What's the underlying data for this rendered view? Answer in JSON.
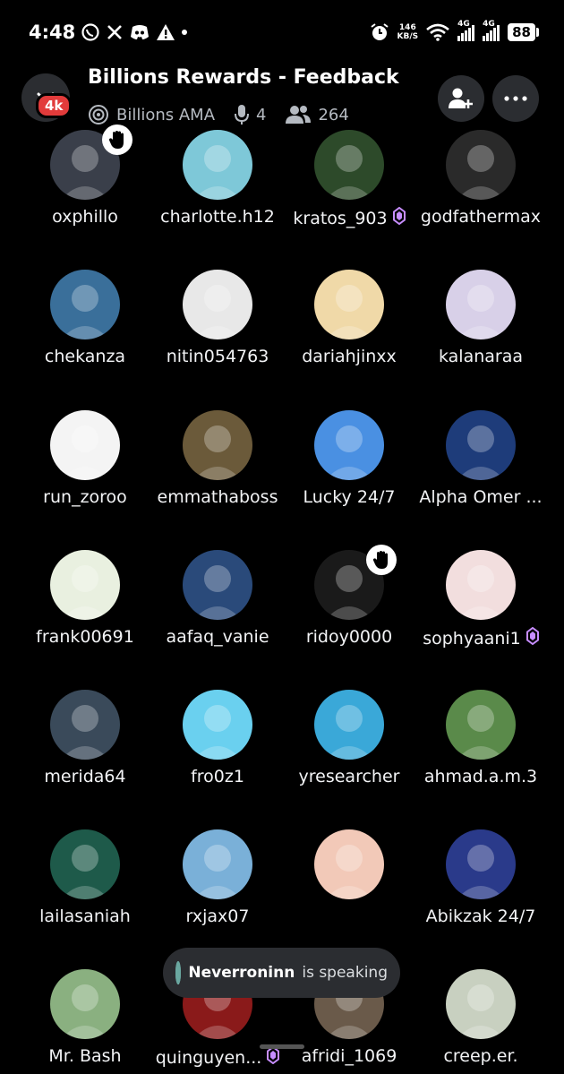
{
  "status_bar": {
    "time": "4:48",
    "net_speed_value": "146",
    "net_speed_unit": "KB/S",
    "sig1_tag": "4G",
    "sig2_tag": "4G",
    "battery": "88"
  },
  "header": {
    "notification_badge": "4k",
    "title": "Billions Rewards - Feedback",
    "stage_name": "Billions AMA",
    "speaker_count": "4",
    "listener_count": "264"
  },
  "participants": [
    {
      "name": "oxphillo",
      "avatar_bg": "#3a3f4a",
      "nitro": false,
      "hand_raised": true
    },
    {
      "name": "charlotte.h12",
      "avatar_bg": "#7ec8d8",
      "nitro": false,
      "hand_raised": false
    },
    {
      "name": "kratos_903",
      "avatar_bg": "#2d4a2a",
      "nitro": true,
      "hand_raised": false
    },
    {
      "name": "godfathermax",
      "avatar_bg": "#2a2a2a",
      "nitro": false,
      "hand_raised": false
    },
    {
      "name": "chekanza",
      "avatar_bg": "#3a6f9a",
      "nitro": false,
      "hand_raised": false
    },
    {
      "name": "nitin054763",
      "avatar_bg": "#e8e8e8",
      "nitro": false,
      "hand_raised": false
    },
    {
      "name": "dariahjinxx",
      "avatar_bg": "#f0d9a8",
      "nitro": false,
      "hand_raised": false
    },
    {
      "name": "kalanaraa",
      "avatar_bg": "#d8d0e8",
      "nitro": false,
      "hand_raised": false
    },
    {
      "name": "run_zoroo",
      "avatar_bg": "#f4f4f4",
      "nitro": false,
      "hand_raised": false
    },
    {
      "name": "emmathaboss",
      "avatar_bg": "#6b5a3a",
      "nitro": false,
      "hand_raised": false
    },
    {
      "name": "Lucky 24/7",
      "avatar_bg": "#4a90e2",
      "nitro": false,
      "hand_raised": false
    },
    {
      "name": "Alpha Omer ...",
      "avatar_bg": "#1e3c7a",
      "nitro": false,
      "hand_raised": false
    },
    {
      "name": "frank00691",
      "avatar_bg": "#e9f0e0",
      "nitro": false,
      "hand_raised": false
    },
    {
      "name": "aafaq_vanie",
      "avatar_bg": "#2a4a7a",
      "nitro": false,
      "hand_raised": false
    },
    {
      "name": "ridoy0000",
      "avatar_bg": "#1a1a1a",
      "nitro": false,
      "hand_raised": true
    },
    {
      "name": "sophyaani1",
      "avatar_bg": "#f2dede",
      "nitro": true,
      "hand_raised": false
    },
    {
      "name": "merida64",
      "avatar_bg": "#3a4a5a",
      "nitro": false,
      "hand_raised": false
    },
    {
      "name": "fro0z1",
      "avatar_bg": "#6ad0ef",
      "nitro": false,
      "hand_raised": false
    },
    {
      "name": "yresearcher",
      "avatar_bg": "#3aa8d8",
      "nitro": false,
      "hand_raised": false
    },
    {
      "name": "ahmad.a.m.3",
      "avatar_bg": "#5a8a4a",
      "nitro": false,
      "hand_raised": false
    },
    {
      "name": "lailasaniah",
      "avatar_bg": "#1e5a4a",
      "nitro": false,
      "hand_raised": false
    },
    {
      "name": "rxjax07",
      "avatar_bg": "#7ab0d8",
      "nitro": false,
      "hand_raised": false
    },
    {
      "name": "",
      "avatar_bg": "#f2c9b8",
      "nitro": false,
      "hand_raised": false
    },
    {
      "name": "Abikzak 24/7",
      "avatar_bg": "#2a3a8a",
      "nitro": false,
      "hand_raised": false
    },
    {
      "name": "Mr. Bash",
      "avatar_bg": "#8ab080",
      "nitro": false,
      "hand_raised": false
    },
    {
      "name": "quinguyen...",
      "avatar_bg": "#8a1a1a",
      "nitro": true,
      "hand_raised": false
    },
    {
      "name": "afridi_1069",
      "avatar_bg": "#6a5a4a",
      "nitro": false,
      "hand_raised": false
    },
    {
      "name": "creep.er.",
      "avatar_bg": "#c8d0c0",
      "nitro": false,
      "hand_raised": false
    }
  ],
  "speaking_toast": {
    "speaker": "Neverroninn",
    "suffix": "is speaking"
  },
  "colors": {
    "background": "#000000",
    "surface": "#2b2d31",
    "nitro": "#c78dff",
    "badge_red": "#e23b3b"
  }
}
